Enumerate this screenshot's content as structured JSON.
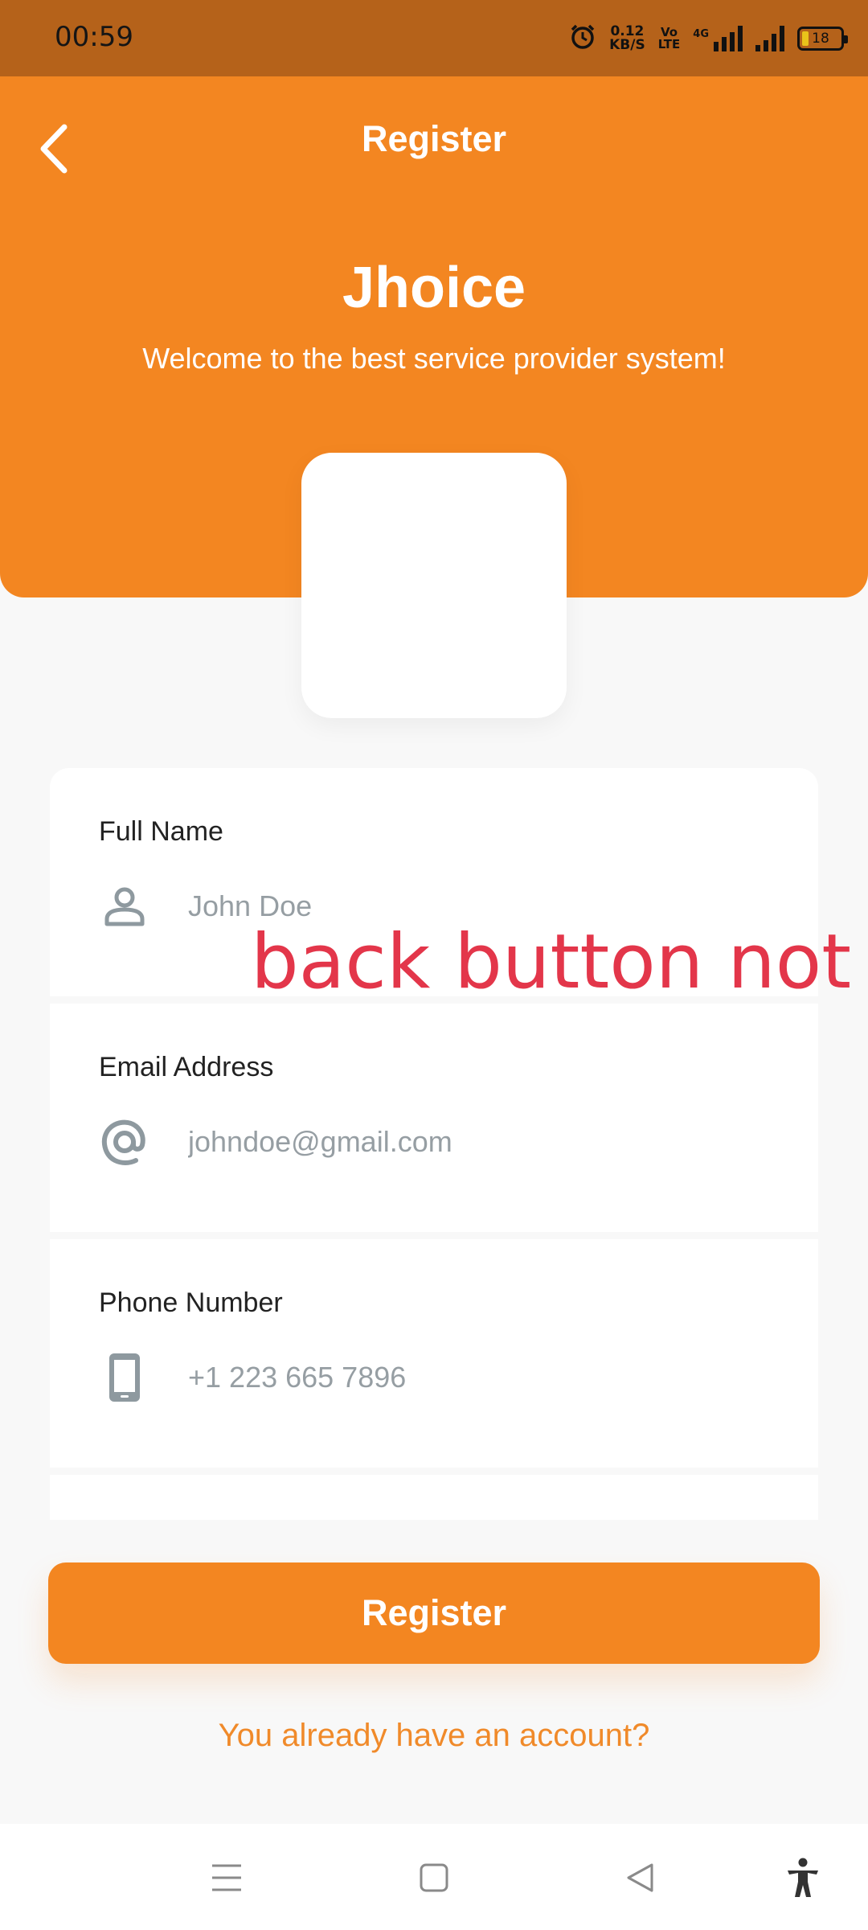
{
  "status_bar": {
    "time": "00:59",
    "net_speed_value": "0.12",
    "net_speed_unit": "KB/S",
    "volte_top": "Vo",
    "volte_bottom": "LTE",
    "network_type": "4G",
    "battery_level": "18",
    "icons": [
      "alarm-icon",
      "signal-icon",
      "signal-icon",
      "battery-icon"
    ]
  },
  "header": {
    "title": "Register",
    "app_name": "Jhoice",
    "tagline": "Welcome to the best service provider system!",
    "accent_color": "#f38621"
  },
  "form": {
    "fields": [
      {
        "label": "Full Name",
        "placeholder": "John Doe",
        "icon": "person-icon"
      },
      {
        "label": "Email Address",
        "placeholder": "johndoe@gmail.com",
        "icon": "at-icon"
      },
      {
        "label": "Phone Number",
        "placeholder": "+1 223 665 7896",
        "icon": "phone-icon"
      }
    ]
  },
  "overlay_note": "back button not w",
  "actions": {
    "register_label": "Register",
    "login_link": "You already have an account?"
  },
  "nav_bar": {
    "icons": [
      "menu-icon",
      "home-icon",
      "back-icon",
      "accessibility-icon"
    ]
  }
}
